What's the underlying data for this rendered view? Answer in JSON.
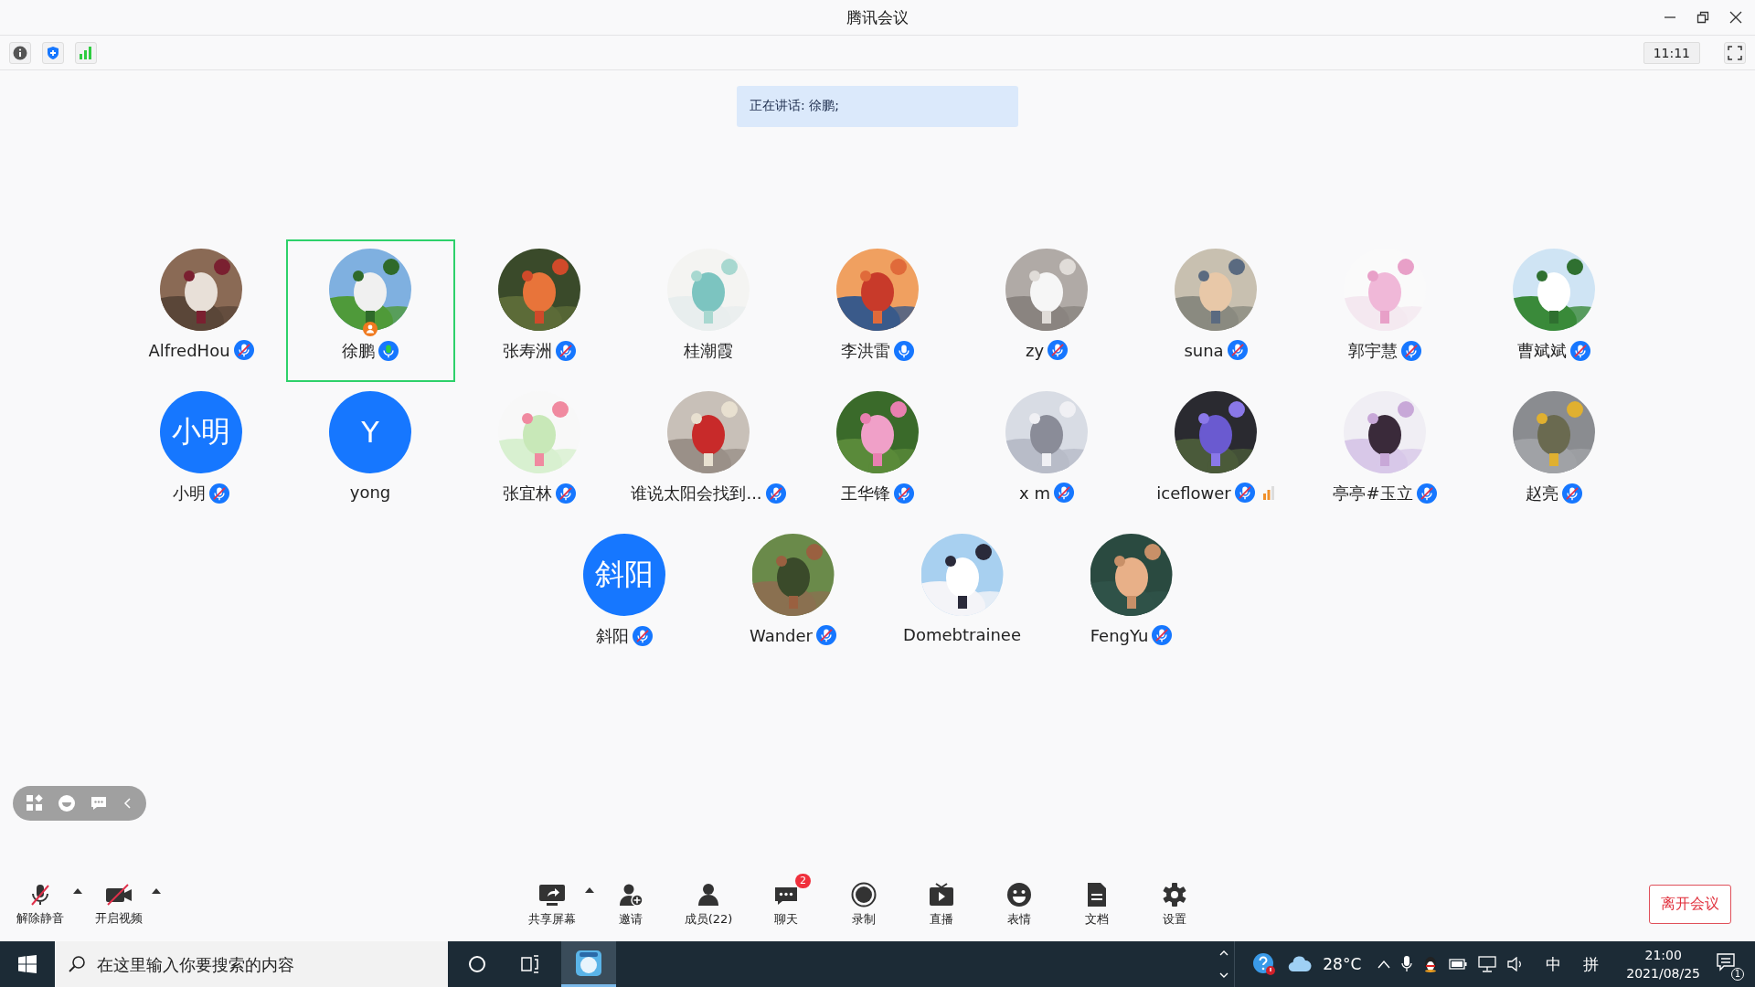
{
  "window": {
    "title": "腾讯会议"
  },
  "top_bar": {
    "timer": "11:11"
  },
  "speaking_banner": "正在讲话: 徐鹏;",
  "participants": [
    {
      "name": "AlfredHou",
      "mic": {
        "kind": "muted"
      },
      "selected": false,
      "host": false,
      "audio_meter": false
    },
    {
      "name": "徐鹏",
      "mic": {
        "kind": "speaking"
      },
      "selected": true,
      "host": true,
      "audio_meter": false
    },
    {
      "name": "张寿洲",
      "mic": {
        "kind": "muted"
      },
      "selected": false,
      "host": false,
      "audio_meter": false
    },
    {
      "name": "桂潮霞",
      "selected": false,
      "host": false,
      "audio_meter": false
    },
    {
      "name": "李洪雷",
      "mic": {
        "kind": "unmuted"
      },
      "selected": false,
      "host": false,
      "audio_meter": false
    },
    {
      "name": "zy",
      "mic": {
        "kind": "muted"
      },
      "selected": false,
      "host": false,
      "audio_meter": false
    },
    {
      "name": "suna",
      "mic": {
        "kind": "muted"
      },
      "selected": false,
      "host": false,
      "audio_meter": false
    },
    {
      "name": "郭宇慧",
      "mic": {
        "kind": "muted"
      },
      "selected": false,
      "host": false,
      "audio_meter": false
    },
    {
      "name": "曹斌斌",
      "mic": {
        "kind": "muted"
      },
      "selected": false,
      "host": false,
      "audio_meter": false
    },
    {
      "name": "小明",
      "avatar": {
        "kind": "initials",
        "text": "小明"
      },
      "mic": {
        "kind": "muted"
      },
      "selected": false,
      "host": false,
      "audio_meter": false
    },
    {
      "name": "yong",
      "avatar": {
        "kind": "initials",
        "text": "Y"
      },
      "selected": false,
      "host": false,
      "audio_meter": false
    },
    {
      "name": "张宜林",
      "mic": {
        "kind": "muted"
      },
      "selected": false,
      "host": false,
      "audio_meter": false
    },
    {
      "name": "谁说太阳会找到...",
      "mic": {
        "kind": "muted"
      },
      "selected": false,
      "host": false,
      "audio_meter": false
    },
    {
      "name": "王华锋",
      "mic": {
        "kind": "muted"
      },
      "selected": false,
      "host": false,
      "audio_meter": false
    },
    {
      "name": "x m",
      "mic": {
        "kind": "muted"
      },
      "selected": false,
      "host": false,
      "audio_meter": false
    },
    {
      "name": "iceflower",
      "mic": {
        "kind": "muted"
      },
      "selected": false,
      "host": false,
      "audio_meter": true
    },
    {
      "name": "亭亭#玉立",
      "mic": {
        "kind": "muted"
      },
      "selected": false,
      "host": false,
      "audio_meter": false
    },
    {
      "name": "赵亮",
      "mic": {
        "kind": "muted"
      },
      "selected": false,
      "host": false,
      "audio_meter": false
    },
    {
      "name": "斜阳",
      "avatar": {
        "kind": "initials",
        "text": "斜阳"
      },
      "mic": {
        "kind": "muted"
      },
      "selected": false,
      "host": false,
      "audio_meter": false
    },
    {
      "name": "Wander",
      "mic": {
        "kind": "muted"
      },
      "selected": false,
      "host": false,
      "audio_meter": false
    },
    {
      "name": "Domebtrainee",
      "selected": false,
      "host": false,
      "audio_meter": false
    },
    {
      "name": "FengYu",
      "mic": {
        "kind": "muted"
      },
      "selected": false,
      "host": false,
      "audio_meter": false
    }
  ],
  "meeting_toolbar": {
    "left": [
      {
        "kind": "mic",
        "label": "解除静音"
      },
      {
        "kind": "video",
        "label": "开启视频"
      }
    ],
    "center": [
      {
        "kind": "share",
        "label": "共享屏幕",
        "menu": true
      },
      {
        "kind": "invite",
        "label": "邀请",
        "menu": false
      },
      {
        "kind": "members",
        "label": "成员(22)",
        "menu": false
      },
      {
        "kind": "chat",
        "label": "聊天",
        "badge": "2",
        "menu": false
      },
      {
        "kind": "record",
        "label": "录制",
        "menu": false
      },
      {
        "kind": "live",
        "label": "直播",
        "menu": false
      },
      {
        "kind": "emoji",
        "label": "表情",
        "menu": false
      },
      {
        "kind": "doc",
        "label": "文档",
        "menu": false
      },
      {
        "kind": "settings",
        "label": "设置",
        "menu": false
      }
    ],
    "leave_button": "离开会议"
  },
  "taskbar": {
    "search_placeholder": "在这里输入你要搜索的内容",
    "weather": "28°C",
    "ime_mode": "中",
    "ime": "拼",
    "time": "21:00",
    "date": "2021/08/25",
    "notifications": "1"
  }
}
